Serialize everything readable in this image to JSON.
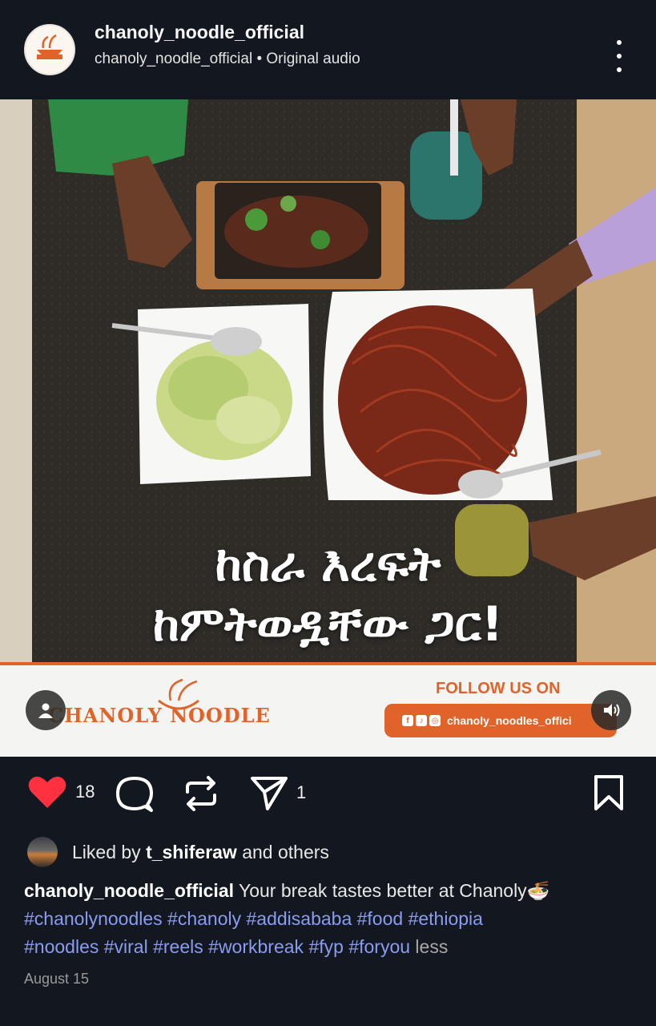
{
  "header": {
    "username": "chanoly_noodle_official",
    "subline": "chanoly_noodle_official • Original audio",
    "avatar_icon": "chanoly-noodle-logo"
  },
  "media": {
    "overlay_line1": "ከስራ እረፍት",
    "overlay_line2": "ከምትወዷቸው ጋር!",
    "brand_logo": "CHANOLY NOODLE",
    "follow_label": "FOLLOW US ON",
    "social_handle": "chanoly_noodles_offici",
    "social_icons": [
      "facebook-icon",
      "tiktok-icon",
      "instagram-icon"
    ]
  },
  "actions": {
    "like_count": "18",
    "share_count": "1",
    "like_color": "#ff3040"
  },
  "likes": {
    "prefix": "Liked by",
    "user": "t_shiferaw",
    "suffix": "and others"
  },
  "caption": {
    "author": "chanoly_noodle_official",
    "text": "Your break tastes better at Chanoly🍜",
    "hashtags": [
      "#chanolynoodles",
      "#chanoly",
      "#addisababa",
      "#food",
      "#ethiopia",
      "#noodles",
      "#viral",
      "#reels",
      "#workbreak",
      "#fyp",
      "#foryou"
    ],
    "less_label": "less"
  },
  "date": "August 15",
  "colors": {
    "background": "#121720",
    "brand_orange": "#e0642a",
    "hashtag": "#8b9cf0"
  }
}
